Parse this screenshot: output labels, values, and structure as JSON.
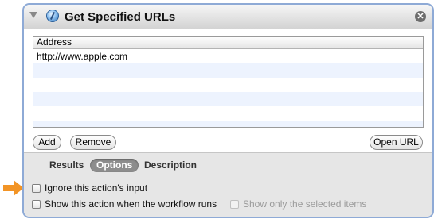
{
  "action": {
    "title": "Get Specified URLs",
    "close_glyph": "✕"
  },
  "table": {
    "column_header": "Address",
    "rows": [
      "http://www.apple.com",
      "",
      "",
      "",
      "",
      ""
    ]
  },
  "buttons": {
    "add": "Add",
    "remove": "Remove",
    "open_url": "Open URL"
  },
  "tabs": [
    {
      "label": "Results",
      "selected": false
    },
    {
      "label": "Options",
      "selected": true
    },
    {
      "label": "Description",
      "selected": false
    }
  ],
  "options": {
    "ignore_input": "Ignore this action's input",
    "show_action": "Show this action when the workflow runs",
    "show_selected": "Show only the selected items"
  },
  "colors": {
    "panel_border": "#8eaad6",
    "selected_tab": "#8d8d8d",
    "arrow": "#f29426"
  },
  "icons": {
    "app": "automator-action-icon",
    "close": "close-icon",
    "disclosure": "disclosure-triangle-icon",
    "pointer": "orange-arrow-icon"
  }
}
